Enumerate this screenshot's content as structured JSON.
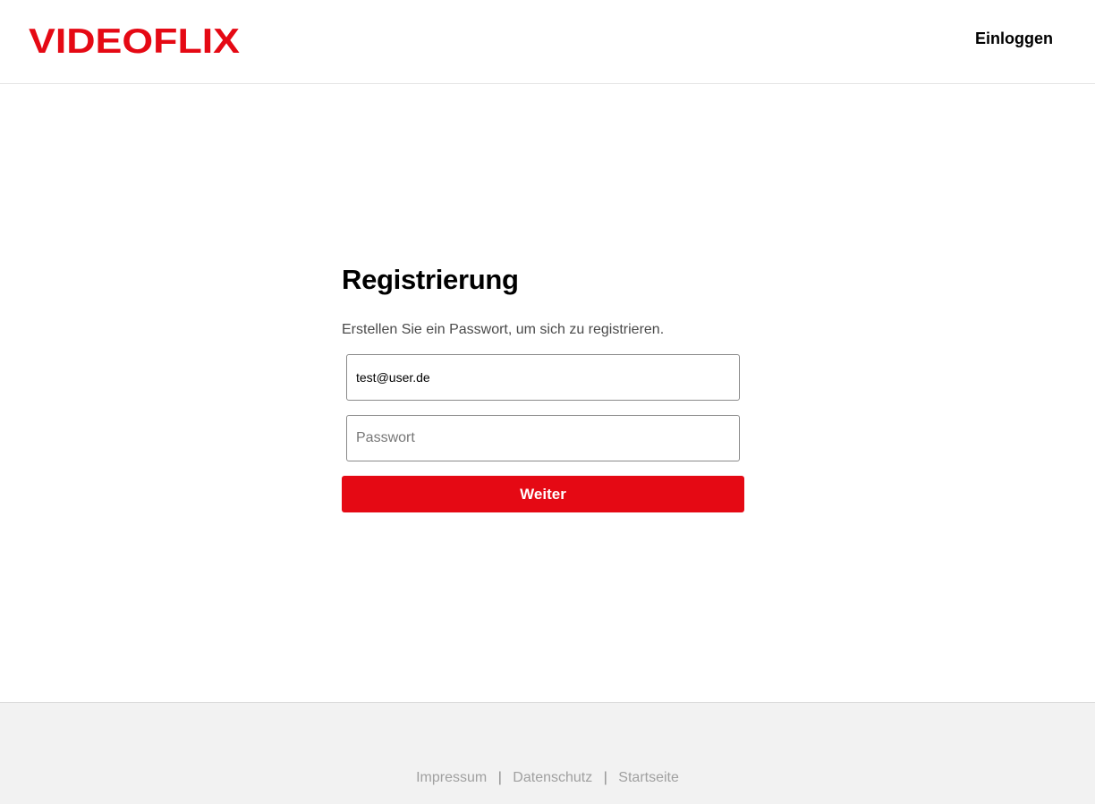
{
  "brand": {
    "name": "VIDEOFLIX",
    "color": "#e50914"
  },
  "header": {
    "login_label": "Einloggen"
  },
  "form": {
    "title": "Registrierung",
    "subtitle": "Erstellen Sie ein Passwort, um sich zu registrieren.",
    "email_value": "test@user.de",
    "password_placeholder": "Passwort",
    "submit_label": "Weiter"
  },
  "footer": {
    "links": [
      "Impressum",
      "Datenschutz",
      "Startseite"
    ],
    "separator": "|"
  }
}
